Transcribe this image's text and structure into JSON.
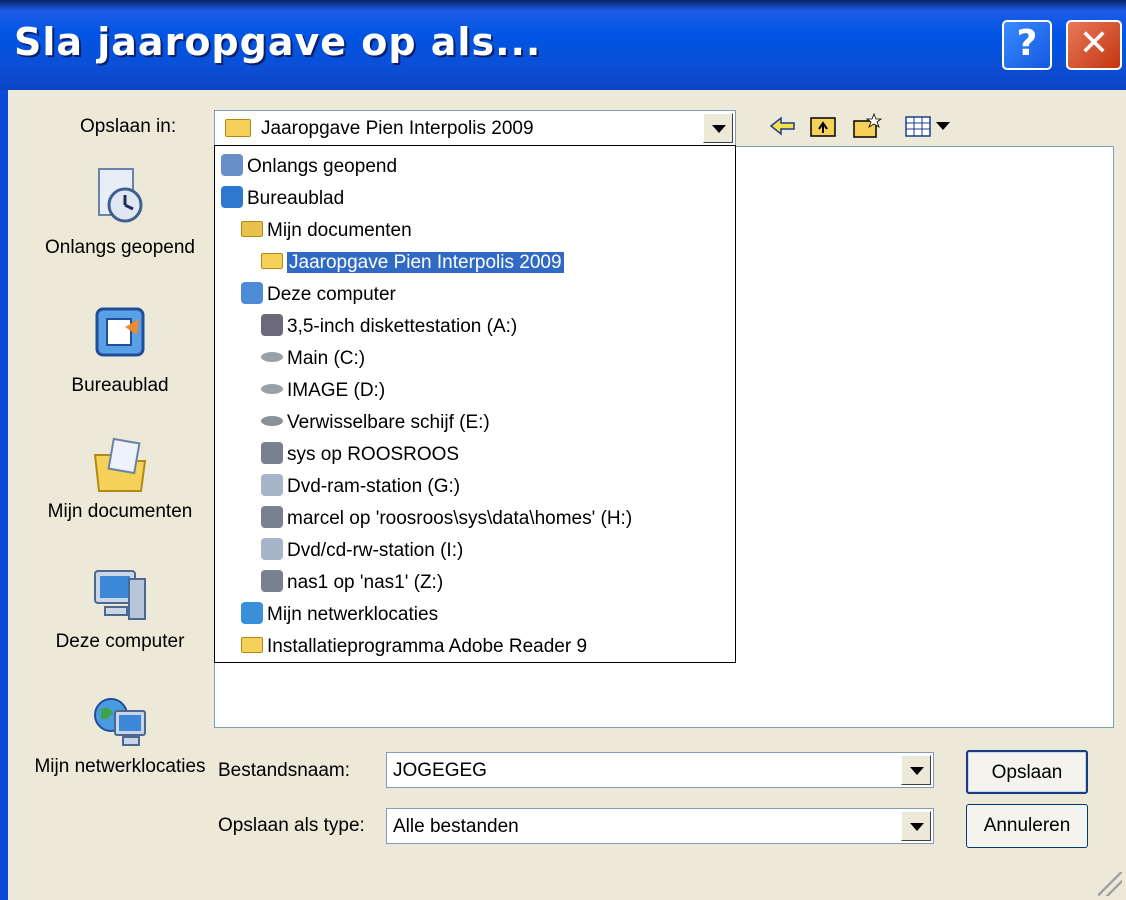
{
  "window": {
    "title": "Sla jaaropgave op als...",
    "help_glyph": "?",
    "close_glyph": "✕"
  },
  "save_in": {
    "label": "Opslaan in:",
    "value": "Jaaropgave Pien Interpolis 2009"
  },
  "toolbar": {
    "icons": [
      "back-icon",
      "up-folder-icon",
      "new-folder-icon",
      "view-menu-icon"
    ]
  },
  "places": [
    {
      "label": "Onlangs geopend",
      "icon": "recent-icon"
    },
    {
      "label": "Bureaublad",
      "icon": "desktop-icon"
    },
    {
      "label": "Mijn documenten",
      "icon": "my-documents-icon"
    },
    {
      "label": "Deze computer",
      "icon": "computer-icon"
    },
    {
      "label": "Mijn netwerklocaties",
      "icon": "network-places-icon"
    }
  ],
  "dropdown": {
    "items": [
      {
        "label": "Onlangs geopend",
        "icon": "recent-icon"
      },
      {
        "label": "Bureaublad",
        "icon": "desktop-icon"
      },
      {
        "label": "Mijn documenten",
        "icon": "my-documents-icon"
      },
      {
        "label": "Jaaropgave Pien Interpolis 2009",
        "icon": "folder-icon",
        "selected": true
      },
      {
        "label": "Deze computer",
        "icon": "computer-icon"
      },
      {
        "label": "3,5-inch diskettestation (A:)",
        "icon": "floppy-icon"
      },
      {
        "label": "Main (C:)",
        "icon": "hard-drive-icon"
      },
      {
        "label": "IMAGE (D:)",
        "icon": "hard-drive-icon"
      },
      {
        "label": "Verwisselbare schijf (E:)",
        "icon": "removable-drive-icon"
      },
      {
        "label": "sys op ROOSROOS",
        "icon": "network-drive-icon"
      },
      {
        "label": "Dvd-ram-station (G:)",
        "icon": "dvd-drive-icon"
      },
      {
        "label": "marcel op 'roosroos\\sys\\data\\homes' (H:)",
        "icon": "network-drive-icon"
      },
      {
        "label": "Dvd/cd-rw-station (I:)",
        "icon": "dvd-drive-icon"
      },
      {
        "label": "nas1 op 'nas1' (Z:)",
        "icon": "network-drive-icon"
      },
      {
        "label": "Mijn netwerklocaties",
        "icon": "network-places-icon"
      },
      {
        "label": "Installatieprogramma Adobe Reader 9",
        "icon": "folder-icon"
      }
    ]
  },
  "filename": {
    "label": "Bestandsnaam:",
    "value": "JOGEGEG"
  },
  "filetype": {
    "label": "Opslaan als type:",
    "value": "Alle bestanden"
  },
  "buttons": {
    "save": "Opslaan",
    "cancel": "Annuleren"
  }
}
